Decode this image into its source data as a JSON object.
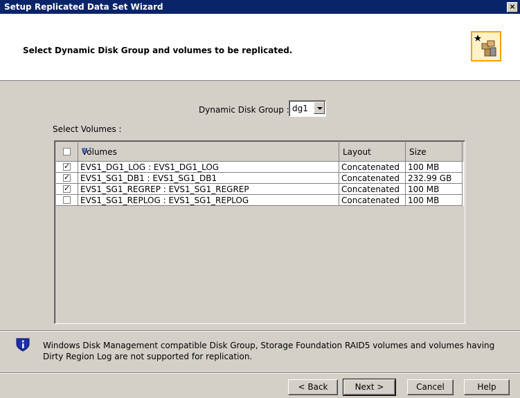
{
  "window": {
    "title": "Setup Replicated Data Set Wizard",
    "close_glyph": "×"
  },
  "header": {
    "title": "Select Dynamic Disk Group and volumes to be replicated."
  },
  "disk_group": {
    "label": "Dynamic Disk Group :",
    "value": "dg1"
  },
  "volumes": {
    "label": "Select Volumes :",
    "columns": [
      "Volumes",
      "Layout",
      "Size"
    ],
    "rows": [
      {
        "checked": true,
        "volume": "EVS1_DG1_LOG : EVS1_DG1_LOG",
        "layout": "Concatenated",
        "size": "100 MB"
      },
      {
        "checked": true,
        "volume": "EVS1_SG1_DB1 : EVS1_SG1_DB1",
        "layout": "Concatenated",
        "size": "232.99 GB"
      },
      {
        "checked": true,
        "volume": "EVS1_SG1_REGREP : EVS1_SG1_REGREP",
        "layout": "Concatenated",
        "size": "100 MB"
      },
      {
        "checked": false,
        "volume": "EVS1_SG1_REPLOG : EVS1_SG1_REPLOG",
        "layout": "Concatenated",
        "size": "100 MB"
      }
    ]
  },
  "info": {
    "text": "Windows Disk Management compatible Disk Group, Storage Foundation RAID5 volumes and volumes having Dirty Region Log are not supported for replication."
  },
  "buttons": {
    "back": "< Back",
    "next": "Next >",
    "cancel": "Cancel",
    "help": "Help"
  },
  "colors": {
    "titlebar": "#0a246a",
    "dialog": "#d4d0c8",
    "logo_border": "#f3a300"
  }
}
